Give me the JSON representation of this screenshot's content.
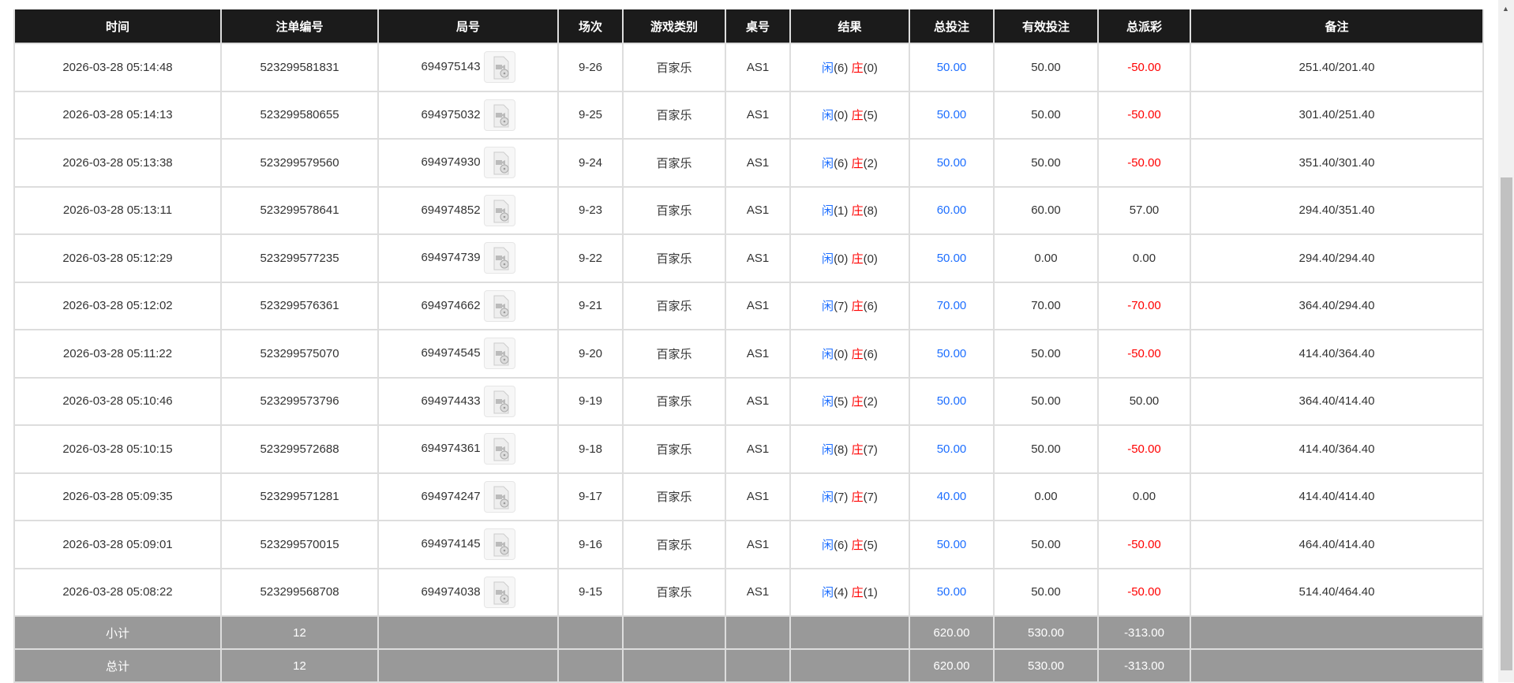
{
  "headers": [
    "时间",
    "注单编号",
    "局号",
    "场次",
    "游戏类别",
    "桌号",
    "结果",
    "总投注",
    "有效投注",
    "总派彩",
    "备注"
  ],
  "colors": {
    "player": "#1e6fff",
    "banker": "#ff0000",
    "bet": "#1e6fff",
    "loss": "#ff0000"
  },
  "rows": [
    {
      "time": "2026-03-28 05:14:48",
      "order": "523299581831",
      "round": "694975143",
      "shoe": "9-26",
      "game": "百家乐",
      "table": "AS1",
      "p": "闲",
      "pv": "(6)",
      "b": "庄",
      "bv": "(0)",
      "bet": "50.00",
      "valid": "50.00",
      "payout": "-50.00",
      "note": "251.40/201.40"
    },
    {
      "time": "2026-03-28 05:14:13",
      "order": "523299580655",
      "round": "694975032",
      "shoe": "9-25",
      "game": "百家乐",
      "table": "AS1",
      "p": "闲",
      "pv": "(0)",
      "b": "庄",
      "bv": "(5)",
      "bet": "50.00",
      "valid": "50.00",
      "payout": "-50.00",
      "note": "301.40/251.40"
    },
    {
      "time": "2026-03-28 05:13:38",
      "order": "523299579560",
      "round": "694974930",
      "shoe": "9-24",
      "game": "百家乐",
      "table": "AS1",
      "p": "闲",
      "pv": "(6)",
      "b": "庄",
      "bv": "(2)",
      "bet": "50.00",
      "valid": "50.00",
      "payout": "-50.00",
      "note": "351.40/301.40"
    },
    {
      "time": "2026-03-28 05:13:11",
      "order": "523299578641",
      "round": "694974852",
      "shoe": "9-23",
      "game": "百家乐",
      "table": "AS1",
      "p": "闲",
      "pv": "(1)",
      "b": "庄",
      "bv": "(8)",
      "bet": "60.00",
      "valid": "60.00",
      "payout": "57.00",
      "note": "294.40/351.40"
    },
    {
      "time": "2026-03-28 05:12:29",
      "order": "523299577235",
      "round": "694974739",
      "shoe": "9-22",
      "game": "百家乐",
      "table": "AS1",
      "p": "闲",
      "pv": "(0)",
      "b": "庄",
      "bv": "(0)",
      "bet": "50.00",
      "valid": "0.00",
      "payout": "0.00",
      "note": "294.40/294.40"
    },
    {
      "time": "2026-03-28 05:12:02",
      "order": "523299576361",
      "round": "694974662",
      "shoe": "9-21",
      "game": "百家乐",
      "table": "AS1",
      "p": "闲",
      "pv": "(7)",
      "b": "庄",
      "bv": "(6)",
      "bet": "70.00",
      "valid": "70.00",
      "payout": "-70.00",
      "note": "364.40/294.40"
    },
    {
      "time": "2026-03-28 05:11:22",
      "order": "523299575070",
      "round": "694974545",
      "shoe": "9-20",
      "game": "百家乐",
      "table": "AS1",
      "p": "闲",
      "pv": "(0)",
      "b": "庄",
      "bv": "(6)",
      "bet": "50.00",
      "valid": "50.00",
      "payout": "-50.00",
      "note": "414.40/364.40"
    },
    {
      "time": "2026-03-28 05:10:46",
      "order": "523299573796",
      "round": "694974433",
      "shoe": "9-19",
      "game": "百家乐",
      "table": "AS1",
      "p": "闲",
      "pv": "(5)",
      "b": "庄",
      "bv": "(2)",
      "bet": "50.00",
      "valid": "50.00",
      "payout": "50.00",
      "note": "364.40/414.40"
    },
    {
      "time": "2026-03-28 05:10:15",
      "order": "523299572688",
      "round": "694974361",
      "shoe": "9-18",
      "game": "百家乐",
      "table": "AS1",
      "p": "闲",
      "pv": "(8)",
      "b": "庄",
      "bv": "(7)",
      "bet": "50.00",
      "valid": "50.00",
      "payout": "-50.00",
      "note": "414.40/364.40"
    },
    {
      "time": "2026-03-28 05:09:35",
      "order": "523299571281",
      "round": "694974247",
      "shoe": "9-17",
      "game": "百家乐",
      "table": "AS1",
      "p": "闲",
      "pv": "(7)",
      "b": "庄",
      "bv": "(7)",
      "bet": "40.00",
      "valid": "0.00",
      "payout": "0.00",
      "note": "414.40/414.40"
    },
    {
      "time": "2026-03-28 05:09:01",
      "order": "523299570015",
      "round": "694974145",
      "shoe": "9-16",
      "game": "百家乐",
      "table": "AS1",
      "p": "闲",
      "pv": "(6)",
      "b": "庄",
      "bv": "(5)",
      "bet": "50.00",
      "valid": "50.00",
      "payout": "-50.00",
      "note": "464.40/414.40"
    },
    {
      "time": "2026-03-28 05:08:22",
      "order": "523299568708",
      "round": "694974038",
      "shoe": "9-15",
      "game": "百家乐",
      "table": "AS1",
      "p": "闲",
      "pv": "(4)",
      "b": "庄",
      "bv": "(1)",
      "bet": "50.00",
      "valid": "50.00",
      "payout": "-50.00",
      "note": "514.40/464.40"
    }
  ],
  "summary": [
    {
      "label": "小计",
      "count": "12",
      "bet": "620.00",
      "valid": "530.00",
      "payout": "-313.00"
    },
    {
      "label": "总计",
      "count": "12",
      "bet": "620.00",
      "valid": "530.00",
      "payout": "-313.00"
    }
  ]
}
